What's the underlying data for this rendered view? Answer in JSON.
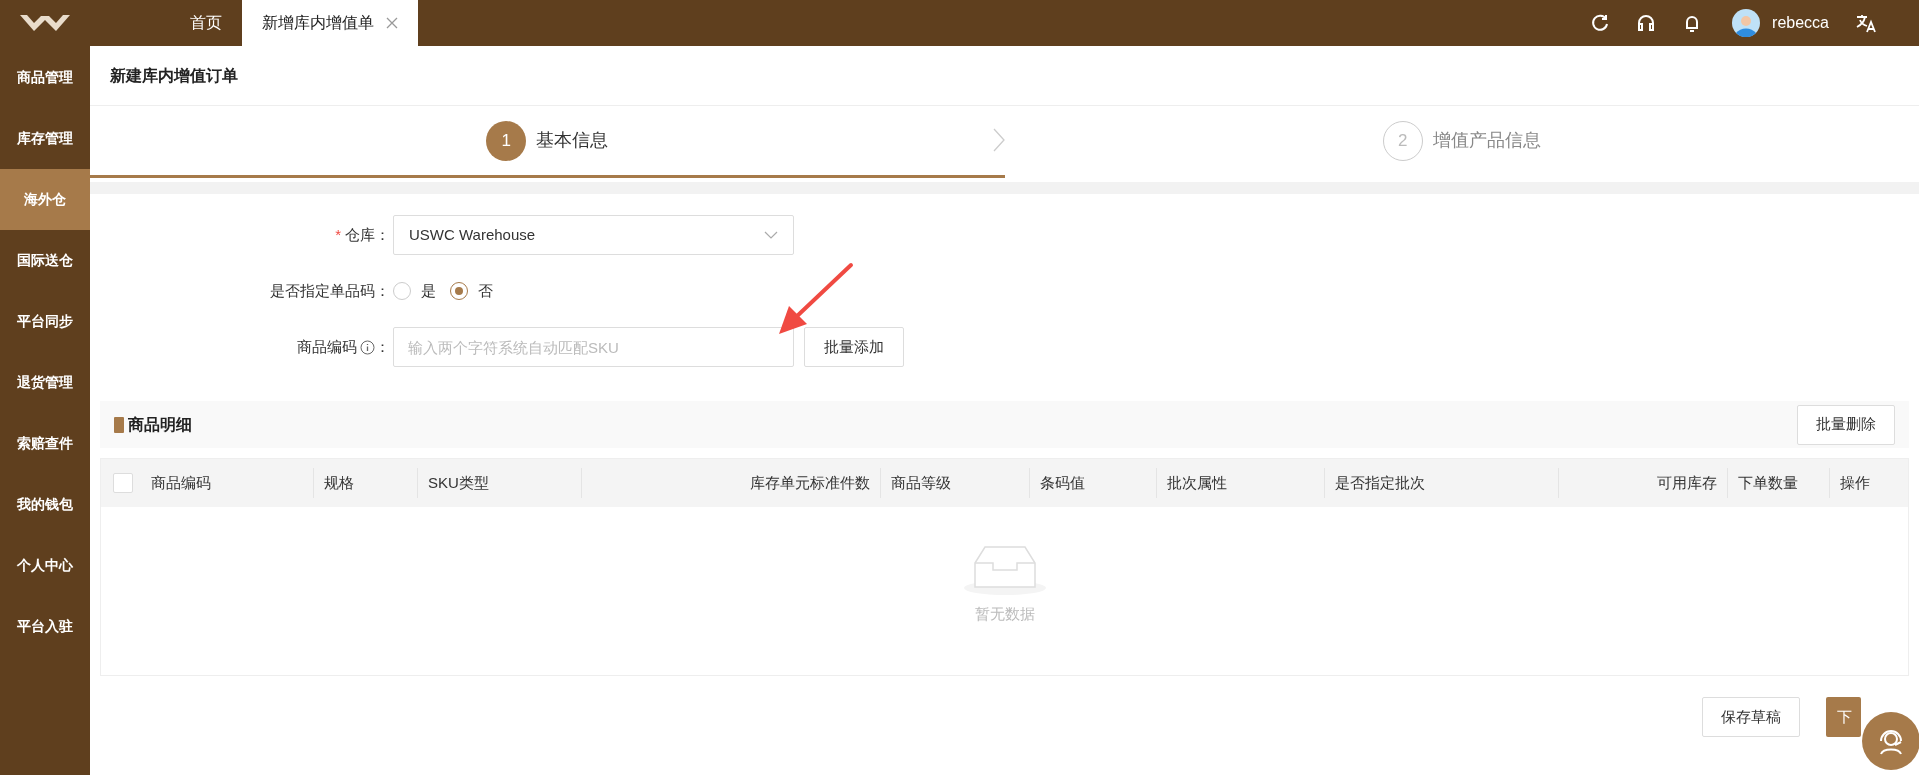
{
  "top_bar": {
    "tabs": [
      {
        "label": "首页",
        "selected": false,
        "closable": false
      },
      {
        "label": "新增库内增值单",
        "selected": true,
        "closable": true
      }
    ],
    "user_name": "rebecca"
  },
  "sidebar": {
    "items": [
      {
        "label": "商品管理",
        "selected": false
      },
      {
        "label": "库存管理",
        "selected": false
      },
      {
        "label": "海外仓",
        "selected": true
      },
      {
        "label": "国际送仓",
        "selected": false
      },
      {
        "label": "平台同步",
        "selected": false
      },
      {
        "label": "退货管理",
        "selected": false
      },
      {
        "label": "索赔查件",
        "selected": false
      },
      {
        "label": "我的钱包",
        "selected": false
      },
      {
        "label": "个人中心",
        "selected": false
      },
      {
        "label": "平台入驻",
        "selected": false
      }
    ]
  },
  "page_title": "新建库内增值订单",
  "steps": [
    {
      "number": "1",
      "label": "基本信息",
      "selected": true
    },
    {
      "number": "2",
      "label": "增值产品信息",
      "selected": false
    }
  ],
  "form": {
    "fields": [
      {
        "kind": "select",
        "label": "仓库",
        "colon": "：",
        "required_mark": "*",
        "value": "USWC Warehouse"
      },
      {
        "kind": "radio",
        "label": "是否指定单品码",
        "colon": "：",
        "options": [
          {
            "label": "是",
            "selected": false
          },
          {
            "label": "否",
            "selected": true
          }
        ]
      },
      {
        "kind": "text",
        "label": "商品编码",
        "colon": "：",
        "info": true,
        "placeholder": "输入两个字符系统自动匹配SKU",
        "button": "批量添加"
      }
    ]
  },
  "section": {
    "title": "商品明细",
    "button": "批量删除"
  },
  "table": {
    "select_all_checked": false,
    "columns": [
      "商品编码",
      "规格",
      "SKU类型",
      "库存单元标准件数",
      "商品等级",
      "条码值",
      "批次属性",
      "是否指定批次",
      "可用库存",
      "下单数量",
      "操作"
    ],
    "empty_text": "暂无数据"
  },
  "footer_buttons": [
    {
      "label": "保存草稿",
      "kind": "default"
    },
    {
      "label": "下",
      "kind": "primary"
    }
  ]
}
